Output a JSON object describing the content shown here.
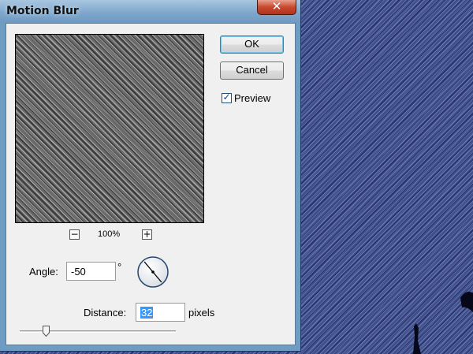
{
  "window": {
    "title": "Motion Blur",
    "close_icon": "✕"
  },
  "preview": {
    "zoom_out_icon": "−",
    "zoom_in_icon": "+",
    "zoom_level": "100%"
  },
  "buttons": {
    "ok_label": "OK",
    "cancel_label": "Cancel"
  },
  "preview_toggle": {
    "label": "Preview",
    "checked": true,
    "check_glyph": "✓"
  },
  "angle": {
    "label": "Angle:",
    "value": "-50",
    "unit": "°",
    "degrees": -50
  },
  "distance": {
    "label": "Distance:",
    "value": "32",
    "unit": "pixels",
    "slider_fraction": 0.16
  },
  "icons": {
    "close": "close-icon",
    "zoom_out": "zoom-out-icon",
    "zoom_in": "zoom-in-icon",
    "checkbox": "checkmark-icon",
    "angle_dial": "angle-dial-icon",
    "slider_thumb": "slider-thumb-icon"
  },
  "colors": {
    "selection": "#3399ff",
    "default_button_border": "#3c7fb1",
    "close_button": "#c84a2e",
    "canvas_blue": "#404f8a"
  }
}
